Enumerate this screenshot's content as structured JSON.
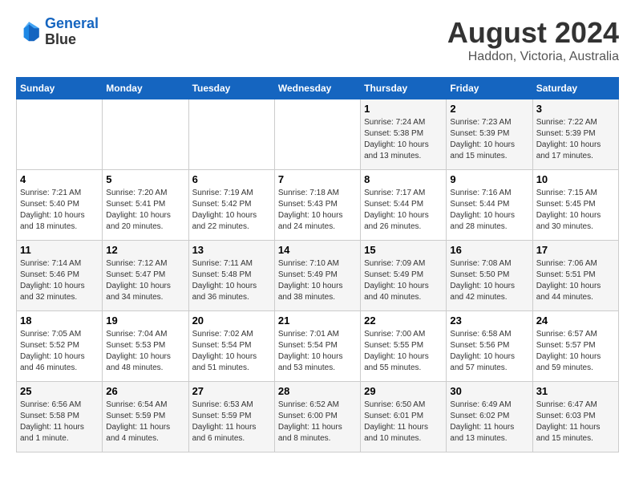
{
  "logo": {
    "line1": "General",
    "line2": "Blue"
  },
  "title": {
    "month_year": "August 2024",
    "location": "Haddon, Victoria, Australia"
  },
  "days_of_week": [
    "Sunday",
    "Monday",
    "Tuesday",
    "Wednesday",
    "Thursday",
    "Friday",
    "Saturday"
  ],
  "weeks": [
    [
      {
        "day": "",
        "sunrise": "",
        "sunset": "",
        "daylight": ""
      },
      {
        "day": "",
        "sunrise": "",
        "sunset": "",
        "daylight": ""
      },
      {
        "day": "",
        "sunrise": "",
        "sunset": "",
        "daylight": ""
      },
      {
        "day": "",
        "sunrise": "",
        "sunset": "",
        "daylight": ""
      },
      {
        "day": "1",
        "sunrise": "Sunrise: 7:24 AM",
        "sunset": "Sunset: 5:38 PM",
        "daylight": "Daylight: 10 hours and 13 minutes."
      },
      {
        "day": "2",
        "sunrise": "Sunrise: 7:23 AM",
        "sunset": "Sunset: 5:39 PM",
        "daylight": "Daylight: 10 hours and 15 minutes."
      },
      {
        "day": "3",
        "sunrise": "Sunrise: 7:22 AM",
        "sunset": "Sunset: 5:39 PM",
        "daylight": "Daylight: 10 hours and 17 minutes."
      }
    ],
    [
      {
        "day": "4",
        "sunrise": "Sunrise: 7:21 AM",
        "sunset": "Sunset: 5:40 PM",
        "daylight": "Daylight: 10 hours and 18 minutes."
      },
      {
        "day": "5",
        "sunrise": "Sunrise: 7:20 AM",
        "sunset": "Sunset: 5:41 PM",
        "daylight": "Daylight: 10 hours and 20 minutes."
      },
      {
        "day": "6",
        "sunrise": "Sunrise: 7:19 AM",
        "sunset": "Sunset: 5:42 PM",
        "daylight": "Daylight: 10 hours and 22 minutes."
      },
      {
        "day": "7",
        "sunrise": "Sunrise: 7:18 AM",
        "sunset": "Sunset: 5:43 PM",
        "daylight": "Daylight: 10 hours and 24 minutes."
      },
      {
        "day": "8",
        "sunrise": "Sunrise: 7:17 AM",
        "sunset": "Sunset: 5:44 PM",
        "daylight": "Daylight: 10 hours and 26 minutes."
      },
      {
        "day": "9",
        "sunrise": "Sunrise: 7:16 AM",
        "sunset": "Sunset: 5:44 PM",
        "daylight": "Daylight: 10 hours and 28 minutes."
      },
      {
        "day": "10",
        "sunrise": "Sunrise: 7:15 AM",
        "sunset": "Sunset: 5:45 PM",
        "daylight": "Daylight: 10 hours and 30 minutes."
      }
    ],
    [
      {
        "day": "11",
        "sunrise": "Sunrise: 7:14 AM",
        "sunset": "Sunset: 5:46 PM",
        "daylight": "Daylight: 10 hours and 32 minutes."
      },
      {
        "day": "12",
        "sunrise": "Sunrise: 7:12 AM",
        "sunset": "Sunset: 5:47 PM",
        "daylight": "Daylight: 10 hours and 34 minutes."
      },
      {
        "day": "13",
        "sunrise": "Sunrise: 7:11 AM",
        "sunset": "Sunset: 5:48 PM",
        "daylight": "Daylight: 10 hours and 36 minutes."
      },
      {
        "day": "14",
        "sunrise": "Sunrise: 7:10 AM",
        "sunset": "Sunset: 5:49 PM",
        "daylight": "Daylight: 10 hours and 38 minutes."
      },
      {
        "day": "15",
        "sunrise": "Sunrise: 7:09 AM",
        "sunset": "Sunset: 5:49 PM",
        "daylight": "Daylight: 10 hours and 40 minutes."
      },
      {
        "day": "16",
        "sunrise": "Sunrise: 7:08 AM",
        "sunset": "Sunset: 5:50 PM",
        "daylight": "Daylight: 10 hours and 42 minutes."
      },
      {
        "day": "17",
        "sunrise": "Sunrise: 7:06 AM",
        "sunset": "Sunset: 5:51 PM",
        "daylight": "Daylight: 10 hours and 44 minutes."
      }
    ],
    [
      {
        "day": "18",
        "sunrise": "Sunrise: 7:05 AM",
        "sunset": "Sunset: 5:52 PM",
        "daylight": "Daylight: 10 hours and 46 minutes."
      },
      {
        "day": "19",
        "sunrise": "Sunrise: 7:04 AM",
        "sunset": "Sunset: 5:53 PM",
        "daylight": "Daylight: 10 hours and 48 minutes."
      },
      {
        "day": "20",
        "sunrise": "Sunrise: 7:02 AM",
        "sunset": "Sunset: 5:54 PM",
        "daylight": "Daylight: 10 hours and 51 minutes."
      },
      {
        "day": "21",
        "sunrise": "Sunrise: 7:01 AM",
        "sunset": "Sunset: 5:54 PM",
        "daylight": "Daylight: 10 hours and 53 minutes."
      },
      {
        "day": "22",
        "sunrise": "Sunrise: 7:00 AM",
        "sunset": "Sunset: 5:55 PM",
        "daylight": "Daylight: 10 hours and 55 minutes."
      },
      {
        "day": "23",
        "sunrise": "Sunrise: 6:58 AM",
        "sunset": "Sunset: 5:56 PM",
        "daylight": "Daylight: 10 hours and 57 minutes."
      },
      {
        "day": "24",
        "sunrise": "Sunrise: 6:57 AM",
        "sunset": "Sunset: 5:57 PM",
        "daylight": "Daylight: 10 hours and 59 minutes."
      }
    ],
    [
      {
        "day": "25",
        "sunrise": "Sunrise: 6:56 AM",
        "sunset": "Sunset: 5:58 PM",
        "daylight": "Daylight: 11 hours and 1 minute."
      },
      {
        "day": "26",
        "sunrise": "Sunrise: 6:54 AM",
        "sunset": "Sunset: 5:59 PM",
        "daylight": "Daylight: 11 hours and 4 minutes."
      },
      {
        "day": "27",
        "sunrise": "Sunrise: 6:53 AM",
        "sunset": "Sunset: 5:59 PM",
        "daylight": "Daylight: 11 hours and 6 minutes."
      },
      {
        "day": "28",
        "sunrise": "Sunrise: 6:52 AM",
        "sunset": "Sunset: 6:00 PM",
        "daylight": "Daylight: 11 hours and 8 minutes."
      },
      {
        "day": "29",
        "sunrise": "Sunrise: 6:50 AM",
        "sunset": "Sunset: 6:01 PM",
        "daylight": "Daylight: 11 hours and 10 minutes."
      },
      {
        "day": "30",
        "sunrise": "Sunrise: 6:49 AM",
        "sunset": "Sunset: 6:02 PM",
        "daylight": "Daylight: 11 hours and 13 minutes."
      },
      {
        "day": "31",
        "sunrise": "Sunrise: 6:47 AM",
        "sunset": "Sunset: 6:03 PM",
        "daylight": "Daylight: 11 hours and 15 minutes."
      }
    ]
  ]
}
